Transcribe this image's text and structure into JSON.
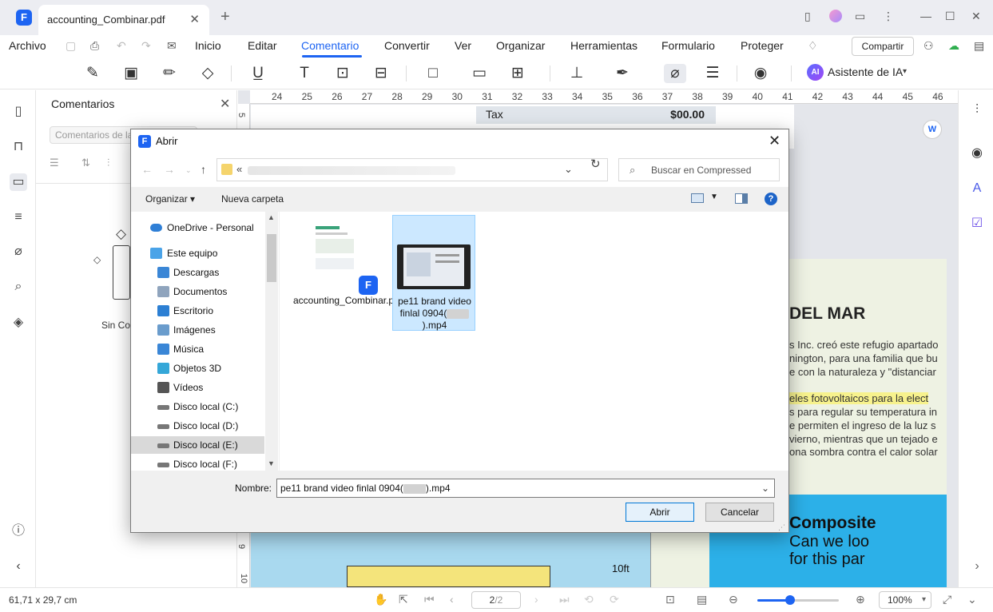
{
  "app": {
    "tab_title": "accounting_Combinar.pdf",
    "tab_close": "✕",
    "new_tab": "+",
    "logo_glyph": "F"
  },
  "menu": {
    "items": [
      "Archivo",
      "Inicio",
      "Editar",
      "Comentario",
      "Convertir",
      "Ver",
      "Organizar",
      "Herramientas",
      "Formulario",
      "Proteger"
    ],
    "active": "Comentario",
    "share_label": "Compartir"
  },
  "toolbar": {
    "ai_badge": "AI",
    "ai_label": "Asistente de IA",
    "icons": [
      "highlighter-icon",
      "sticky-note-icon",
      "pencil-icon",
      "eraser-icon",
      "underline-icon",
      "text-icon",
      "textbox-icon",
      "callout-icon",
      "shape-icon",
      "comment-box-icon",
      "measure-icon",
      "stamp-icon",
      "signature-icon",
      "attachment-icon",
      "markup-list-icon",
      "eye-icon"
    ]
  },
  "comments_panel": {
    "title": "Comentarios",
    "search_placeholder": "Comentarios de la",
    "empty_label": "Sin Co"
  },
  "ruler": {
    "marks": [
      "24",
      "25",
      "26",
      "27",
      "28",
      "29",
      "30",
      "31",
      "32",
      "33",
      "34",
      "35",
      "36",
      "37",
      "38",
      "39",
      "40",
      "41",
      "42",
      "43",
      "44",
      "45",
      "46"
    ],
    "vertical_marks": [
      "5",
      "9",
      "10"
    ]
  },
  "document": {
    "tax_label": "Tax",
    "tax_value": "$00.00",
    "section_title": "DEL MAR",
    "body_lines": [
      "s Inc. creó este refugio apartado",
      "nington, para una familia que bu",
      "e con la naturaleza y \"distanciar",
      "eles fotovoltaicos para la elect",
      "s para regular su temperatura in",
      "e permiten el ingreso de la luz s",
      "vierno, mientras que un tejado e",
      "ona sombra contra el calor solar"
    ],
    "comp_title": "Composite",
    "comp_lines": [
      "Can we loo",
      "for this par"
    ],
    "dimension_label": "10ft"
  },
  "status": {
    "dimensions": "61,71 x 29,7 cm",
    "page": "2",
    "page_total": "/2",
    "zoom": "100%",
    "zoom_level": 0.4
  },
  "dialog": {
    "title": "Abrir",
    "address_prefix": "«",
    "search_placeholder": "Buscar en Compressed",
    "organize_label": "Organizar ▾",
    "new_folder_label": "Nueva carpeta",
    "help_label": "?",
    "nav_items": [
      {
        "label": "OneDrive - Personal",
        "icon": "cloud-icon",
        "color": "#2f7fd6"
      },
      {
        "label": "Este equipo",
        "icon": "computer-icon",
        "color": "#4aa3e8"
      },
      {
        "label": "Descargas",
        "icon": "download-icon",
        "color": "#3a86d6"
      },
      {
        "label": "Documentos",
        "icon": "document-icon",
        "color": "#8fa4bd"
      },
      {
        "label": "Escritorio",
        "icon": "desktop-icon",
        "color": "#2c7fd3"
      },
      {
        "label": "Imágenes",
        "icon": "pictures-icon",
        "color": "#6a9ccc"
      },
      {
        "label": "Música",
        "icon": "music-icon",
        "color": "#3a86d6"
      },
      {
        "label": "Objetos 3D",
        "icon": "cube-icon",
        "color": "#35a7d8"
      },
      {
        "label": "Vídeos",
        "icon": "video-icon",
        "color": "#555555"
      },
      {
        "label": "Disco local (C:)",
        "icon": "drive-icon",
        "color": "#777777"
      },
      {
        "label": "Disco local (D:)",
        "icon": "drive-icon",
        "color": "#777777"
      },
      {
        "label": "Disco local (E:)",
        "icon": "drive-icon",
        "color": "#777777"
      },
      {
        "label": "Disco local (F:)",
        "icon": "drive-icon",
        "color": "#777777"
      }
    ],
    "selected_nav": "Disco local (E:)",
    "files": [
      {
        "name": "accounting_Combinar.pdf",
        "type": "pdf"
      },
      {
        "name_prefix": "pe11 brand video finlal 0904(",
        "name_suffix": ").mp4",
        "type": "video",
        "selected": true
      }
    ],
    "filename_label": "Nombre:",
    "filename_prefix": "pe11 brand video finlal 0904(",
    "filename_suffix": ").mp4",
    "open_label": "Abrir",
    "cancel_label": "Cancelar"
  },
  "colors": {
    "accent": "#1d64f2",
    "selection": "#cce8ff",
    "doc_blue": "#2cb0e8",
    "highlight": "#f7f28d"
  }
}
